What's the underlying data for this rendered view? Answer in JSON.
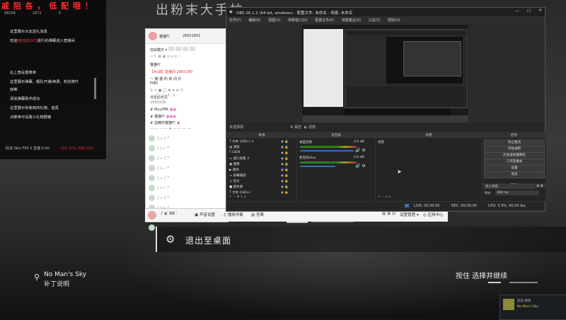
{
  "overlay_title": "戚 阻 各 ， 低 配 哦 ！",
  "big_banner": "出粉末大手拉",
  "chat": {
    "stats": [
      "98294",
      "2872",
      "0"
    ],
    "messages": [
      {
        "text": "这里展示大友送礼消息",
        "highlight": ""
      },
      {
        "text": "欢迎",
        "highlight": "[粉丝][LV3]",
        "suffix": "进行的弹幕进入直播间"
      },
      {
        "text": "右上角设置菜单",
        "highlight": ""
      },
      {
        "text": "这里展示弹幕、舰队开通/续费、粉丝牌升",
        "highlight": ""
      },
      {
        "text": "级等",
        "highlight": ""
      },
      {
        "text": "添加弹幕助手成功",
        "highlight": ""
      },
      {
        "text": "这里展示你收到的礼物、道具",
        "highlight": ""
      },
      {
        "text": "点菜单可设置小礼物屏蔽",
        "highlight": ""
      }
    ],
    "footer_left": "码流 0k/s  FPS 0  直播 0:00",
    "footer_right": "CPU 10%  内存 20%"
  },
  "live_panel": {
    "user_id": "26651801",
    "user_name": "猫猫吖",
    "mode": "自由模式",
    "menu_items": [
      "猫猫吖",
      "【Ac战】直播间 2665180",
      "一 猫 猫 的 房 间 乐",
      "PIBS",
      "点击后可见",
      "VERSION"
    ],
    "viewers": [
      "Moy/MB",
      "猫猫吖",
      "血精的猫猫吖"
    ],
    "list_label": "最近观看"
  },
  "live_toolbar": {
    "items": [
      "声音设置",
      "播放伴奏",
      "答案",
      "直播录像"
    ],
    "right_label": "设置管理",
    "window_title_right": "应用中心"
  },
  "obs": {
    "title": "OBS 26.1.2 (64-bit, windows) - 配置文件: 未命名 - 场景: 未命名",
    "menu": [
      "文件(F)",
      "编辑(E)",
      "视图(V)",
      "停靠窗口(D)",
      "配置文件(P)",
      "场景集合(S)",
      "工具(T)",
      "帮助(H)"
    ],
    "preview_bar": [
      "未选择源",
      "属性",
      "滤镜"
    ],
    "docks": {
      "scenes_title": "场景",
      "sources_title": "来源",
      "mixer_title": "混音器",
      "transitions_title": "转场",
      "controls_title": "控件"
    },
    "sources": [
      "文本 (GDI+) 2",
      "演唱",
      "GIEN",
      "窗口采集 3",
      "图像",
      "媒体",
      "屏幕捕获",
      "音乐",
      "颜色源",
      "文本 (GDI+)"
    ],
    "mixer": [
      {
        "name": "桌面音频",
        "db": "0.0 dB",
        "level": 0.9
      },
      {
        "name": "麦克风/Aux",
        "db": "0.0 dB",
        "level": 0.6
      }
    ],
    "scene": "场景",
    "controls": [
      "停止推流",
      "开始录制",
      "启动虚拟摄像机",
      "工作室模式",
      "设置",
      "退出"
    ],
    "transition": {
      "type": "淡入淡出",
      "duration_label": "时长",
      "duration": "300 ms"
    },
    "status": [
      "LIVE: 00:00:00",
      "REC: 00:00:00",
      "CPU: 5.9%, 60.00 fps"
    ]
  },
  "game": {
    "exit_label": "退出至桌面",
    "game_name": "No Man's Sky",
    "patch_notes": "补丁说明",
    "continue_text": "按住  选择并继续"
  },
  "toast": {
    "line1": "成就 解锁",
    "line2": "No Man's Sky"
  },
  "colors": {
    "accent_red": "#ff2b2b",
    "obs_bg": "#2b2b2b"
  }
}
